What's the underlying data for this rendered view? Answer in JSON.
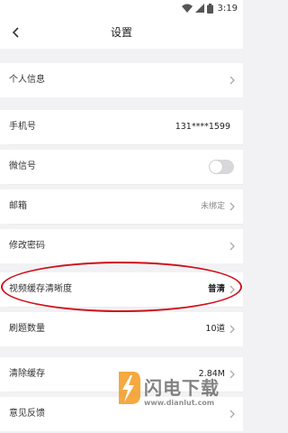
{
  "status_bar": {
    "time": "3:19"
  },
  "header": {
    "title": "设置"
  },
  "rows": {
    "personal_info": {
      "label": "个人信息"
    },
    "phone": {
      "label": "手机号",
      "value": "131****1599"
    },
    "wechat": {
      "label": "微信号",
      "toggle_on": false
    },
    "email": {
      "label": "邮箱",
      "value": "未绑定"
    },
    "password": {
      "label": "修改密码"
    },
    "video_quality": {
      "label": "视频缓存清晰度",
      "value": "普清"
    },
    "question_count": {
      "label": "刷题数量",
      "value": "10道"
    },
    "clear_cache": {
      "label": "清除缓存",
      "value": "2.84M"
    },
    "feedback": {
      "label": "意见反馈"
    }
  },
  "colors": {
    "background": "#f2f2f4",
    "highlight_ellipse": "#d0101a",
    "watermark_orange": "#f39a1e"
  }
}
